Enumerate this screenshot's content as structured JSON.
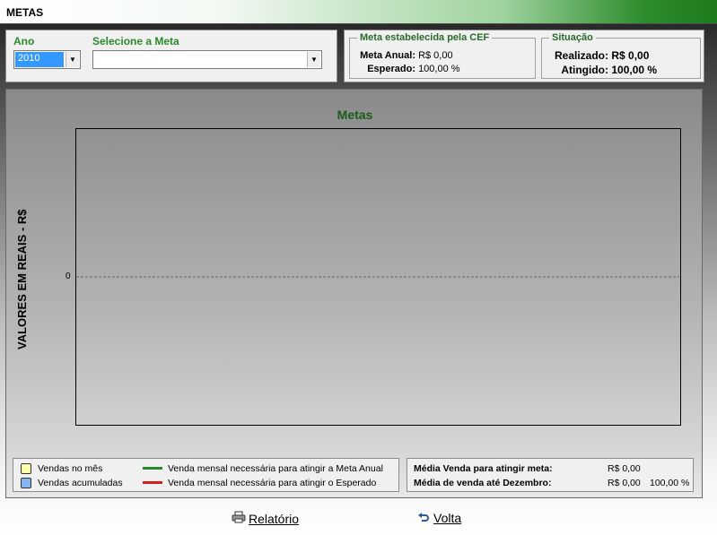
{
  "window": {
    "title": "METAS"
  },
  "filters": {
    "ano_label": "Ano",
    "ano_value": "2010",
    "meta_label": "Selecione a Meta",
    "meta_value": ""
  },
  "meta_cef": {
    "legend": "Meta estabelecida pela CEF",
    "meta_anual_label": "Meta Anual:",
    "meta_anual_value": "R$ 0,00",
    "esperado_label": "Esperado:",
    "esperado_value": "100,00 %"
  },
  "situacao": {
    "legend": "Situação",
    "realizado_label": "Realizado:",
    "realizado_value": "R$ 0,00",
    "atingido_label": "Atingido:",
    "atingido_value": "100,00 %"
  },
  "chart_data": {
    "type": "bar",
    "title": "Metas",
    "ylabel": "VALORES EM REAIS - R$",
    "xlabel": "",
    "categories": [],
    "series": [],
    "y_ticks": [
      "0"
    ],
    "grid": "dashed zero line",
    "legend": [
      {
        "label": "Vendas no mês",
        "color": "#ffffb0",
        "kind": "swatch"
      },
      {
        "label": "Vendas acumuladas",
        "color": "#86b6ef",
        "kind": "swatch"
      },
      {
        "label": "Venda mensal necessária para atingir a Meta Anual",
        "color": "#2a8a2a",
        "kind": "line"
      },
      {
        "label": "Venda mensal necessária para atingir o Esperado",
        "color": "#d42020",
        "kind": "line"
      }
    ]
  },
  "medias": {
    "meta_label": "Média Venda para atingir meta:",
    "meta_value": "R$ 0,00",
    "dez_label": "Média de venda até Dezembro:",
    "dez_value": "R$ 0,00",
    "dez_pct": "100,00 %"
  },
  "actions": {
    "relatorio_label": "Relatório",
    "volta_label": "Volta"
  },
  "icons": {
    "printer": "printer-icon",
    "back": "back-arrow-icon"
  }
}
